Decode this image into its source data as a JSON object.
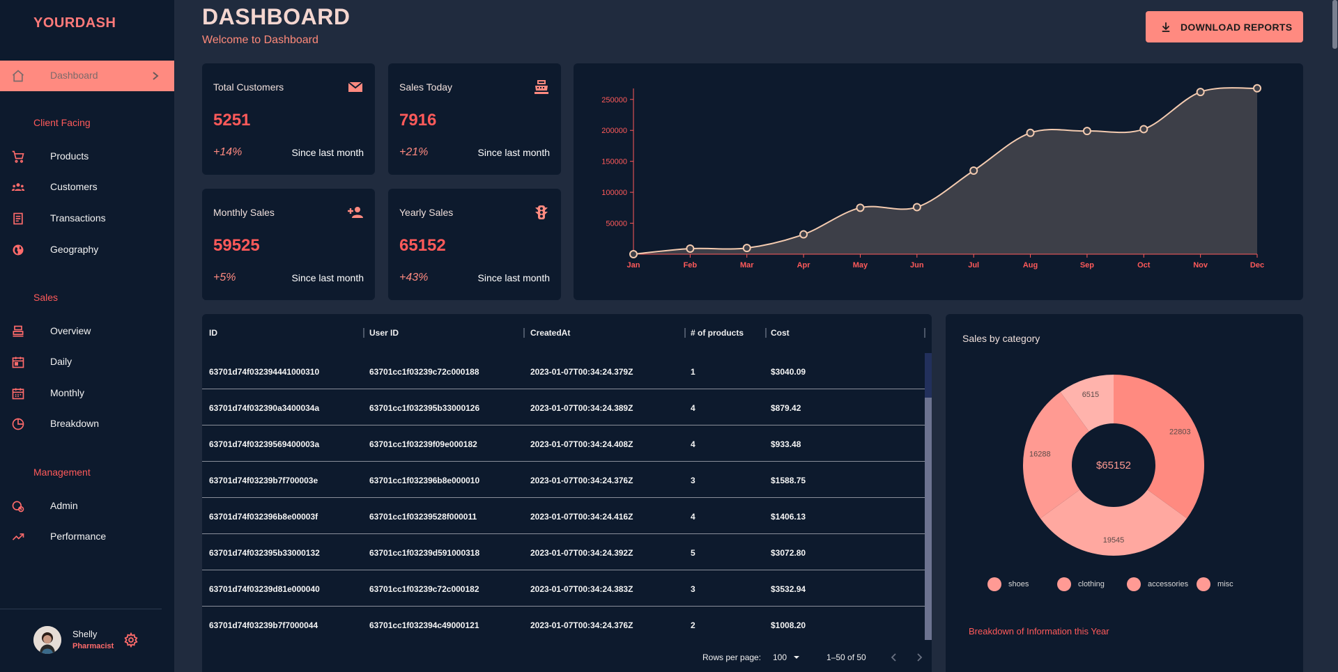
{
  "brand": "YOURDASH",
  "sidebar": {
    "active": {
      "label": "Dashboard",
      "icon": "home-icon"
    },
    "sections": [
      {
        "title": "Client Facing",
        "items": [
          {
            "label": "Products",
            "icon": "shopping-cart-icon"
          },
          {
            "label": "Customers",
            "icon": "groups-icon"
          },
          {
            "label": "Transactions",
            "icon": "receipt-icon"
          },
          {
            "label": "Geography",
            "icon": "globe-icon"
          }
        ]
      },
      {
        "title": "Sales",
        "items": [
          {
            "label": "Overview",
            "icon": "point-of-sale-icon"
          },
          {
            "label": "Daily",
            "icon": "calendar-today-icon"
          },
          {
            "label": "Monthly",
            "icon": "calendar-month-icon"
          },
          {
            "label": "Breakdown",
            "icon": "pie-chart-icon"
          }
        ]
      },
      {
        "title": "Management",
        "items": [
          {
            "label": "Admin",
            "icon": "admin-icon"
          },
          {
            "label": "Performance",
            "icon": "trending-up-icon"
          }
        ]
      }
    ],
    "user": {
      "name": "Shelly",
      "role": "Pharmacist"
    }
  },
  "header": {
    "title": "DASHBOARD",
    "subtitle": "Welcome to Dashboard",
    "download_label": "DOWNLOAD REPORTS"
  },
  "stats": [
    {
      "title": "Total Customers",
      "value": "5251",
      "change": "+14%",
      "since": "Since last month",
      "icon": "email-icon"
    },
    {
      "title": "Sales Today",
      "value": "7916",
      "change": "+21%",
      "since": "Since last month",
      "icon": "point-of-sale-icon"
    },
    {
      "title": "Monthly Sales",
      "value": "59525",
      "change": "+5%",
      "since": "Since last month",
      "icon": "person-add-icon"
    },
    {
      "title": "Yearly Sales",
      "value": "65152",
      "change": "+43%",
      "since": "Since last month",
      "icon": "traffic-icon"
    }
  ],
  "chart_data": [
    {
      "type": "area",
      "categories": [
        "Jan",
        "Feb",
        "Mar",
        "Apr",
        "May",
        "Jun",
        "Jul",
        "Aug",
        "Sep",
        "Oct",
        "Nov",
        "Dec"
      ],
      "values": [
        0,
        9000,
        10000,
        32000,
        75000,
        76000,
        135000,
        196000,
        199000,
        202000,
        262000,
        268000
      ],
      "yticks": [
        50000,
        100000,
        150000,
        200000,
        250000
      ],
      "ylim": [
        0,
        270000
      ],
      "title": "",
      "xlabel": "",
      "ylabel": "",
      "colors": {
        "line": "#f4cbb0",
        "fill": "#3d3f48",
        "axis": "#ff5a5a"
      }
    },
    {
      "type": "pie",
      "title": "Sales by category",
      "center_label": "$65152",
      "slices": [
        {
          "name": "shoes",
          "value": 22803,
          "color": "#ff8a80"
        },
        {
          "name": "clothing",
          "value": 19545,
          "color": "#ffa8a0"
        },
        {
          "name": "accessories",
          "value": 16288,
          "color": "#ff9a92"
        },
        {
          "name": "misc",
          "value": 6515,
          "color": "#ffb3ac"
        }
      ]
    }
  ],
  "table": {
    "columns": [
      "ID",
      "User ID",
      "CreatedAt",
      "# of products",
      "Cost"
    ],
    "rows": [
      [
        "63701d74f032394441000310",
        "63701cc1f03239c72c000188",
        "2023-01-07T00:34:24.379Z",
        "1",
        "$3040.09"
      ],
      [
        "63701d74f032390a3400034a",
        "63701cc1f032395b33000126",
        "2023-01-07T00:34:24.389Z",
        "4",
        "$879.42"
      ],
      [
        "63701d74f03239569400003a",
        "63701cc1f03239f09e000182",
        "2023-01-07T00:34:24.408Z",
        "4",
        "$933.48"
      ],
      [
        "63701d74f03239b7f700003e",
        "63701cc1f032396b8e000010",
        "2023-01-07T00:34:24.376Z",
        "3",
        "$1588.75"
      ],
      [
        "63701d74f032396b8e00003f",
        "63701cc1f03239528f000011",
        "2023-01-07T00:34:24.416Z",
        "4",
        "$1406.13"
      ],
      [
        "63701d74f032395b33000132",
        "63701cc1f03239d591000318",
        "2023-01-07T00:34:24.392Z",
        "5",
        "$3072.80"
      ],
      [
        "63701d74f03239d81e000040",
        "63701cc1f03239c72c000182",
        "2023-01-07T00:34:24.383Z",
        "3",
        "$3532.94"
      ],
      [
        "63701d74f03239b7f7000044",
        "63701cc1f032394c49000121",
        "2023-01-07T00:34:24.376Z",
        "2",
        "$1008.20"
      ]
    ],
    "rows_per_page_label": "Rows per page:",
    "rows_per_page": "100",
    "range": "1–50 of 50"
  },
  "pie_note": "Breakdown of Information this Year"
}
